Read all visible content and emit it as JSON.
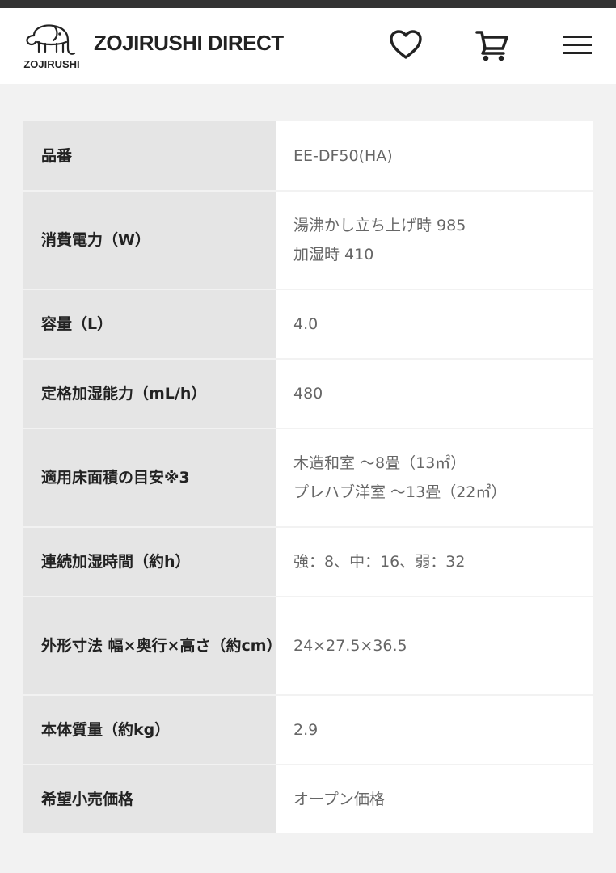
{
  "header": {
    "logo_text": "ZOJIRUSHI",
    "brand": "ZOJIRUSHI DIRECT",
    "icons": [
      "heart-icon",
      "cart-icon",
      "menu-icon"
    ]
  },
  "specs": [
    {
      "label": "品番",
      "value": [
        "EE-DF50(HA)"
      ]
    },
    {
      "label": "消費電力（W）",
      "value": [
        "湯沸かし立ち上げ時 985",
        "加湿時 410"
      ]
    },
    {
      "label": "容量（L）",
      "value": [
        "4.0"
      ]
    },
    {
      "label": "定格加湿能力（mL/h）",
      "value": [
        "480"
      ]
    },
    {
      "label": "適用床面積の目安※3",
      "value": [
        "木造和室 〜8畳（13㎡）",
        "プレハブ洋室 〜13畳（22㎡）"
      ]
    },
    {
      "label": "連続加湿時間（約h）",
      "value": [
        "強：8、中：16、弱：32"
      ]
    },
    {
      "label": "外形寸法 幅×奥行×高さ（約cm）",
      "value": [
        "24×27.5×36.5"
      ]
    },
    {
      "label": "本体質量（約kg）",
      "value": [
        "2.9"
      ]
    },
    {
      "label": "希望小売価格",
      "value": [
        "オープン価格"
      ]
    }
  ]
}
